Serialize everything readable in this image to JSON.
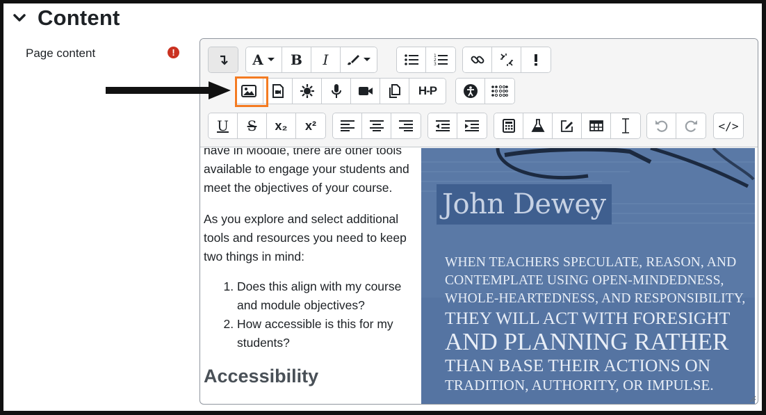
{
  "section": {
    "title": "Content"
  },
  "field": {
    "label": "Page content",
    "required_icon": "!"
  },
  "toolbar": {
    "row1": [
      "collapse-icon",
      "font-family-icon",
      "bold-icon",
      "italic-icon",
      "color-icon",
      "unordered-list-icon",
      "ordered-list-icon",
      "link-icon",
      "unlink-icon",
      "emoji-icon"
    ],
    "row2": [
      "image-icon",
      "media-icon",
      "recordrtc-icon",
      "audio-icon",
      "video-icon",
      "manage-files-icon",
      "h5p-icon",
      "accessibility-checker-icon",
      "screenreader-helper-icon"
    ],
    "row3": [
      "underline-icon",
      "strikethrough-icon",
      "subscript-icon",
      "superscript-icon",
      "align-left-icon",
      "align-center-icon",
      "align-right-icon",
      "outdent-icon",
      "indent-icon",
      "equation-icon",
      "chemistry-icon",
      "edit-icon",
      "table-icon",
      "clear-formatting-icon",
      "undo-icon",
      "redo-icon",
      "html-icon"
    ],
    "bold_label": "B",
    "italic_label": "I",
    "font_label": "A",
    "h5p_label": "H-P",
    "subscript_label": "x₂",
    "superscript_label": "x²",
    "html_label": "</>"
  },
  "content": {
    "partial_line": "have in Moodle, there are other tools",
    "para1": "available to engage your students and meet the objectives of your course.",
    "para2": "As you explore and select additional tools and resources you need to keep two things in mind:",
    "list": [
      "Does this align with my course and module objectives?",
      "How accessible is this for my students?"
    ],
    "heading": "Accessibility"
  },
  "image": {
    "name": "John Dewey",
    "quote_lines": [
      "WHEN TEACHERS SPECULATE, REASON, AND",
      "CONTEMPLATE USING OPEN-MINDEDNESS,",
      "WHOLE-HEARTEDNESS, AND RESPONSIBILITY,",
      "THEY WILL ACT WITH FORESIGHT",
      "AND PLANNING RATHER",
      "THAN BASE THEIR ACTIONS ON",
      "TRADITION, AUTHORITY, OR IMPULSE."
    ]
  },
  "colors": {
    "highlight": "#f47b22",
    "required": "#ca3120",
    "image_bg": "#5b7aa8"
  }
}
